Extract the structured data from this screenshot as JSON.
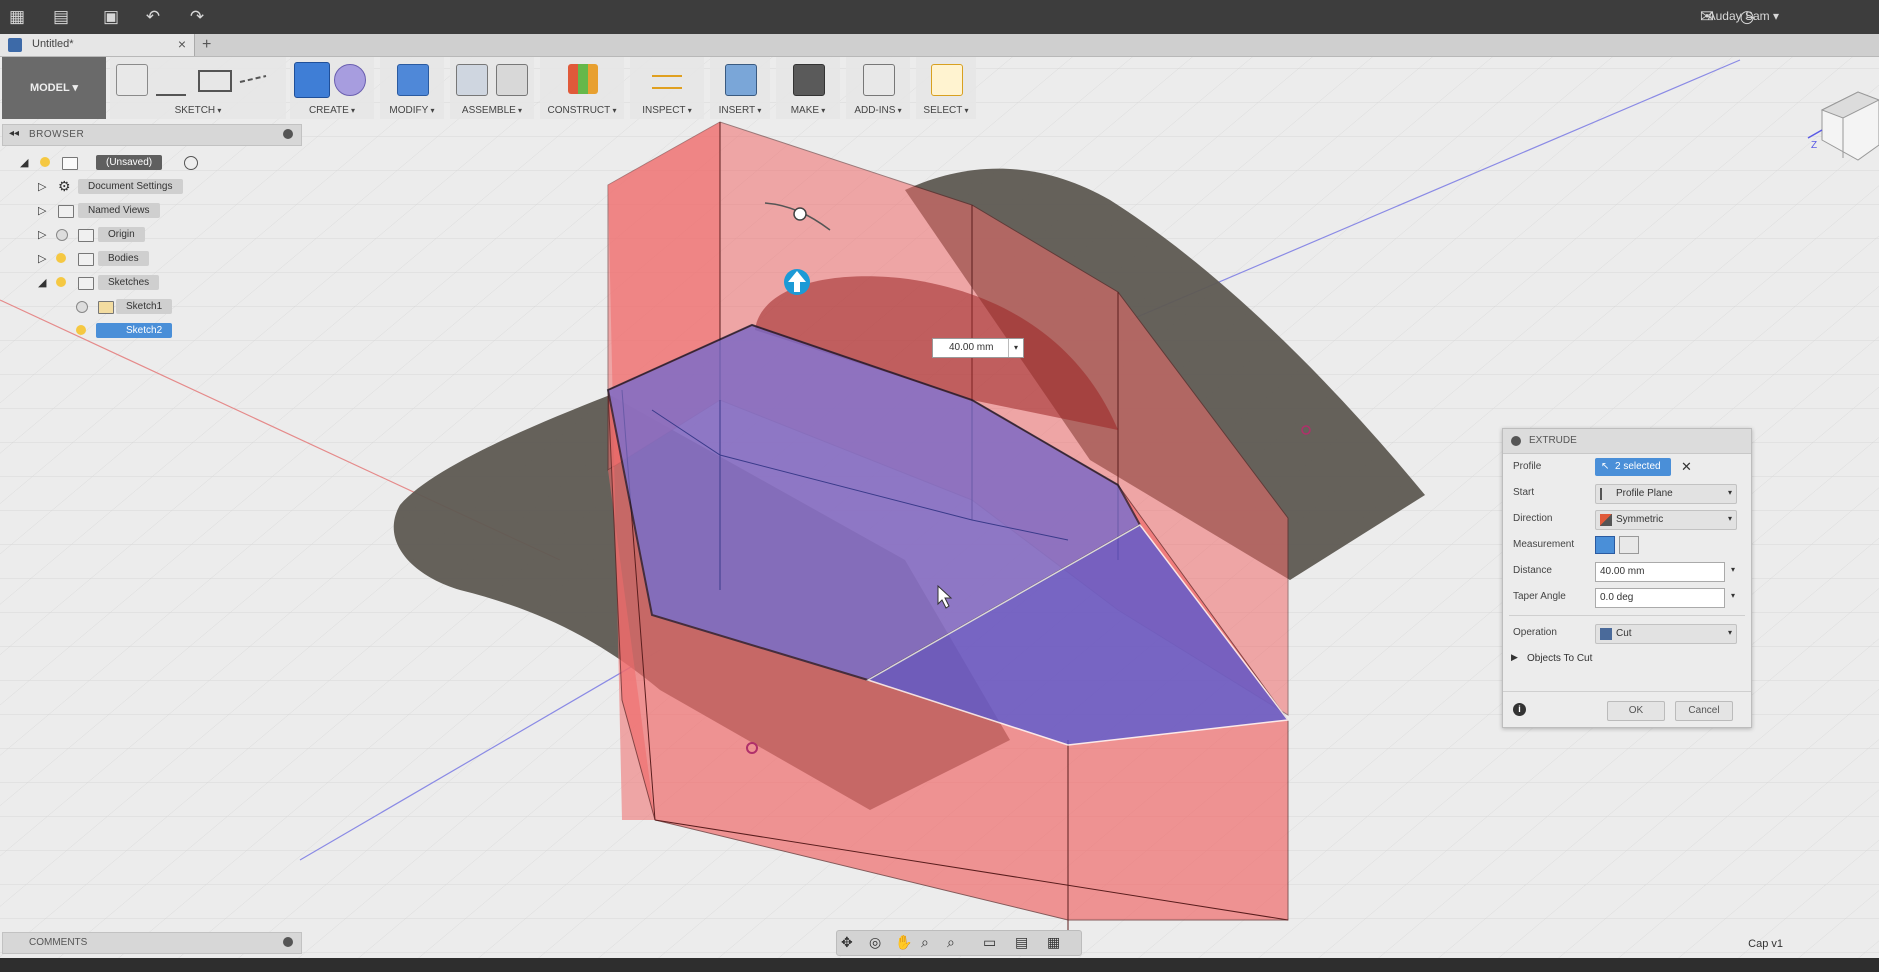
{
  "topbar": {
    "user": "Auday Sam"
  },
  "tab": {
    "title": "Untitled*",
    "close": "×",
    "new": "+"
  },
  "toolbar": {
    "workspace": "MODEL",
    "groups": {
      "sketch": "SKETCH",
      "create": "CREATE",
      "modify": "MODIFY",
      "assemble": "ASSEMBLE",
      "construct": "CONSTRUCT",
      "inspect": "INSPECT",
      "insert": "INSERT",
      "make": "MAKE",
      "addins": "ADD-INS",
      "select": "SELECT"
    }
  },
  "browser": {
    "title": "BROWSER",
    "root": "(Unsaved)",
    "items": [
      {
        "label": "Document Settings"
      },
      {
        "label": "Named Views"
      },
      {
        "label": "Origin"
      },
      {
        "label": "Bodies"
      },
      {
        "label": "Sketches"
      },
      {
        "label": "Sketch1"
      },
      {
        "label": "Sketch2"
      }
    ]
  },
  "viewport": {
    "dimension_value": "40.00 mm",
    "viewcube_axis": "Z"
  },
  "extrude": {
    "title": "EXTRUDE",
    "fields": {
      "profile_label": "Profile",
      "profile_value": "2 selected",
      "start_label": "Start",
      "start_value": "Profile Plane",
      "direction_label": "Direction",
      "direction_value": "Symmetric",
      "measurement_label": "Measurement",
      "distance_label": "Distance",
      "distance_value": "40.00 mm",
      "taper_label": "Taper Angle",
      "taper_value": "0.0 deg",
      "operation_label": "Operation",
      "operation_value": "Cut",
      "objects_to_cut": "Objects To Cut"
    },
    "ok": "OK",
    "cancel": "Cancel"
  },
  "comments": {
    "title": "COMMENTS"
  },
  "status": {
    "text": "Cap v1"
  },
  "colors": {
    "extrude_red": "#f06c6c",
    "profile_blue": "#6f6fd6",
    "body_gray": "#5e5a52",
    "accent_blue": "#4a8fd8"
  }
}
